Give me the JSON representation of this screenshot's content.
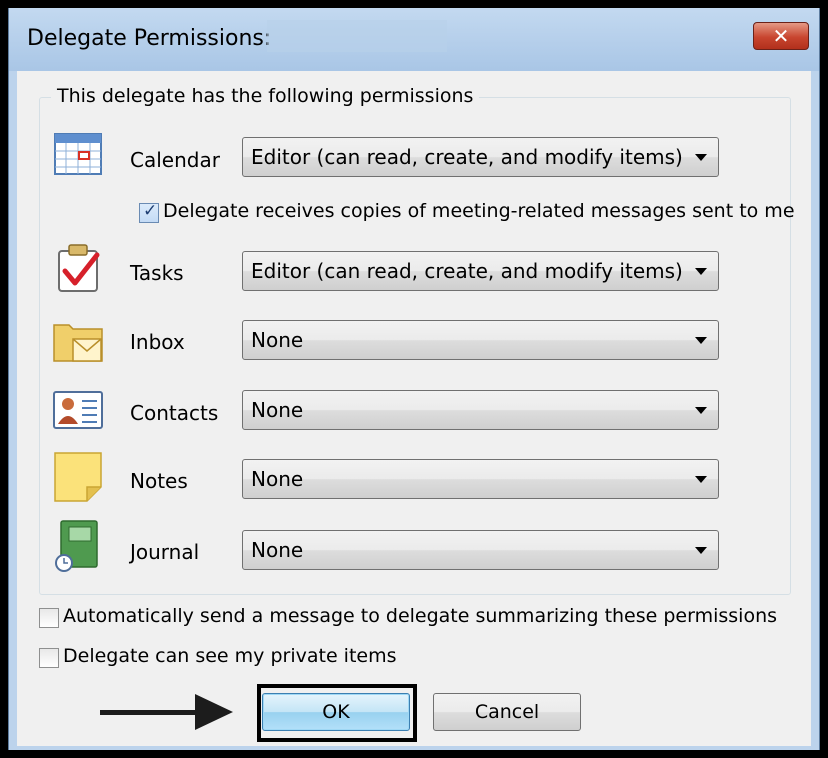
{
  "window": {
    "title": "Delegate Permissions:",
    "close_label": "✕"
  },
  "group": {
    "legend": "This delegate has the following permissions"
  },
  "rows": [
    {
      "label": "Calendar",
      "value": "Editor (can read, create, and modify items)",
      "icon": "calendar-icon"
    },
    {
      "label": "Tasks",
      "value": "Editor (can read, create, and modify items)",
      "icon": "tasks-icon"
    },
    {
      "label": "Inbox",
      "value": "None",
      "icon": "inbox-icon"
    },
    {
      "label": "Contacts",
      "value": "None",
      "icon": "contacts-icon"
    },
    {
      "label": "Notes",
      "value": "None",
      "icon": "notes-icon"
    },
    {
      "label": "Journal",
      "value": "None",
      "icon": "journal-icon"
    }
  ],
  "checkboxes": {
    "meeting_copies": {
      "label": "Delegate receives copies of meeting-related messages sent to me",
      "checked": true
    },
    "auto_send": {
      "label": "Automatically send a message to delegate summarizing these permissions",
      "checked": false
    },
    "private_items": {
      "label": "Delegate can see my private items",
      "checked": false
    }
  },
  "buttons": {
    "ok_label": "OK",
    "cancel_label": "Cancel"
  },
  "colors": {
    "titlebar": "#bcd3ec",
    "dialog_bg": "#f0f0f0",
    "close_red": "#c8452f",
    "default_button": "#98d1ef"
  }
}
